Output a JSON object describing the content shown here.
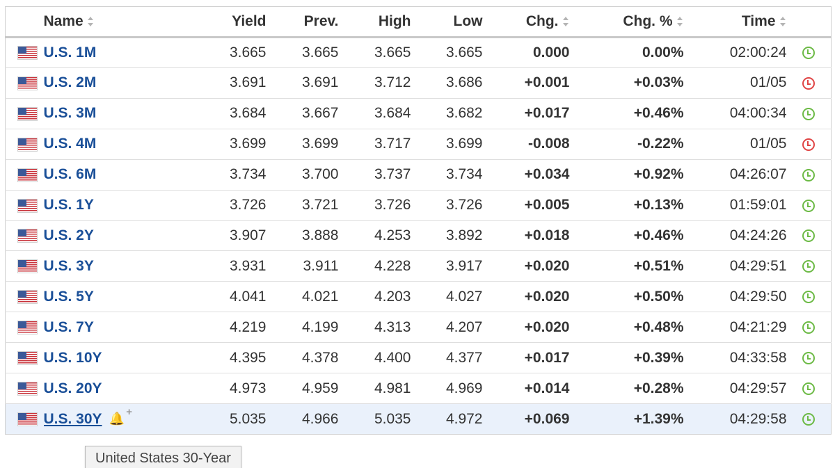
{
  "columns": {
    "name": "Name",
    "yield": "Yield",
    "prev": "Prev.",
    "high": "High",
    "low": "Low",
    "chg": "Chg.",
    "chg_pct": "Chg. %",
    "time": "Time"
  },
  "rows": [
    {
      "name": "U.S. 1M",
      "yield": "3.665",
      "prev": "3.665",
      "high": "3.665",
      "low": "3.665",
      "chg": "0.000",
      "chg_pct": "0.00%",
      "time": "02:00:24",
      "direction": "zero",
      "clock": "green-clock-icon"
    },
    {
      "name": "U.S. 2M",
      "yield": "3.691",
      "prev": "3.691",
      "high": "3.712",
      "low": "3.686",
      "chg": "+0.001",
      "chg_pct": "+0.03%",
      "time": "01/05",
      "direction": "up",
      "clock": "red-clock-icon"
    },
    {
      "name": "U.S. 3M",
      "yield": "3.684",
      "prev": "3.667",
      "high": "3.684",
      "low": "3.682",
      "chg": "+0.017",
      "chg_pct": "+0.46%",
      "time": "04:00:34",
      "direction": "up",
      "clock": "green-clock-icon"
    },
    {
      "name": "U.S. 4M",
      "yield": "3.699",
      "prev": "3.699",
      "high": "3.717",
      "low": "3.699",
      "chg": "-0.008",
      "chg_pct": "-0.22%",
      "time": "01/05",
      "direction": "down",
      "clock": "red-clock-icon"
    },
    {
      "name": "U.S. 6M",
      "yield": "3.734",
      "prev": "3.700",
      "high": "3.737",
      "low": "3.734",
      "chg": "+0.034",
      "chg_pct": "+0.92%",
      "time": "04:26:07",
      "direction": "up",
      "clock": "green-clock-icon"
    },
    {
      "name": "U.S. 1Y",
      "yield": "3.726",
      "prev": "3.721",
      "high": "3.726",
      "low": "3.726",
      "chg": "+0.005",
      "chg_pct": "+0.13%",
      "time": "01:59:01",
      "direction": "up",
      "clock": "green-clock-icon"
    },
    {
      "name": "U.S. 2Y",
      "yield": "3.907",
      "prev": "3.888",
      "high": "4.253",
      "low": "3.892",
      "chg": "+0.018",
      "chg_pct": "+0.46%",
      "time": "04:24:26",
      "direction": "up",
      "clock": "green-clock-icon"
    },
    {
      "name": "U.S. 3Y",
      "yield": "3.931",
      "prev": "3.911",
      "high": "4.228",
      "low": "3.917",
      "chg": "+0.020",
      "chg_pct": "+0.51%",
      "time": "04:29:51",
      "direction": "up",
      "clock": "green-clock-icon"
    },
    {
      "name": "U.S. 5Y",
      "yield": "4.041",
      "prev": "4.021",
      "high": "4.203",
      "low": "4.027",
      "chg": "+0.020",
      "chg_pct": "+0.50%",
      "time": "04:29:50",
      "direction": "up",
      "clock": "green-clock-icon"
    },
    {
      "name": "U.S. 7Y",
      "yield": "4.219",
      "prev": "4.199",
      "high": "4.313",
      "low": "4.207",
      "chg": "+0.020",
      "chg_pct": "+0.48%",
      "time": "04:21:29",
      "direction": "up",
      "clock": "green-clock-icon"
    },
    {
      "name": "U.S. 10Y",
      "yield": "4.395",
      "prev": "4.378",
      "high": "4.400",
      "low": "4.377",
      "chg": "+0.017",
      "chg_pct": "+0.39%",
      "time": "04:33:58",
      "direction": "up",
      "clock": "green-clock-icon"
    },
    {
      "name": "U.S. 20Y",
      "yield": "4.973",
      "prev": "4.959",
      "high": "4.981",
      "low": "4.969",
      "chg": "+0.014",
      "chg_pct": "+0.28%",
      "time": "04:29:57",
      "direction": "up",
      "clock": "green-clock-icon"
    },
    {
      "name": "U.S. 30Y",
      "yield": "5.035",
      "prev": "4.966",
      "high": "5.035",
      "low": "4.972",
      "chg": "+0.069",
      "chg_pct": "+1.39%",
      "time": "04:29:58",
      "direction": "up",
      "clock": "green-clock-icon",
      "hovered": true
    }
  ],
  "tooltip": "United States 30-Year",
  "colors": {
    "link_blue": "#1a4f98",
    "positive_green": "#3a9c2c",
    "negative_red": "#d93025",
    "hover_row": "#eaf1fb"
  },
  "icons": {
    "flag": "us-flag-icon",
    "sort": "sort-arrows-icon",
    "alert": "bell-plus-icon"
  }
}
